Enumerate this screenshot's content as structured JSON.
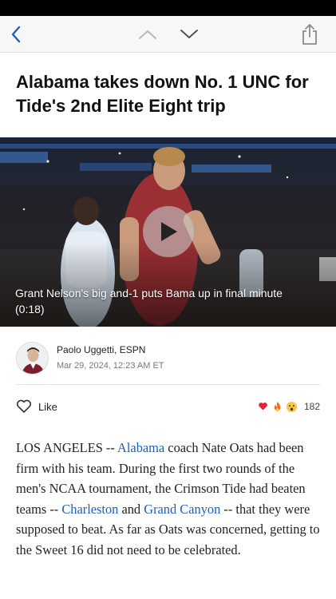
{
  "nav": {
    "back_icon": "chevron-left-icon",
    "prev_icon": "chevron-up-icon",
    "next_icon": "chevron-down-icon",
    "share_icon": "share-icon",
    "accent_color": "#1d5fb5"
  },
  "article": {
    "headline": "Alabama takes down No. 1 UNC for Tide's 2nd Elite Eight trip",
    "video": {
      "caption": "Grant Nelson's big and-1 puts Bama up in final minute",
      "duration": "(0:18)",
      "play_icon": "play-icon"
    },
    "author": {
      "name": "Paolo Uggetti, ESPN",
      "date": "Mar 29, 2024, 12:23 AM ET"
    },
    "engagement": {
      "like_label": "Like",
      "like_icon": "heart-outline-icon",
      "reaction_icons": [
        "heart-icon",
        "fire-icon",
        "shocked-face-icon"
      ],
      "reaction_count": "182"
    },
    "body": {
      "p1_text_a": "LOS ANGELES -- ",
      "p1_link_alabama": "Alabama",
      "p1_text_b": " coach Nate Oats had been firm with his team. During the first two rounds of the men's NCAA tournament, the Crimson Tide had beaten teams -- ",
      "p1_link_charleston": "Charleston",
      "p1_text_c": " and ",
      "p1_link_grand_canyon": "Grand Canyon",
      "p1_text_d": " -- that they were supposed to beat. As far as Oats was concerned, getting to the Sweet 16 did not need to be celebrated."
    }
  }
}
